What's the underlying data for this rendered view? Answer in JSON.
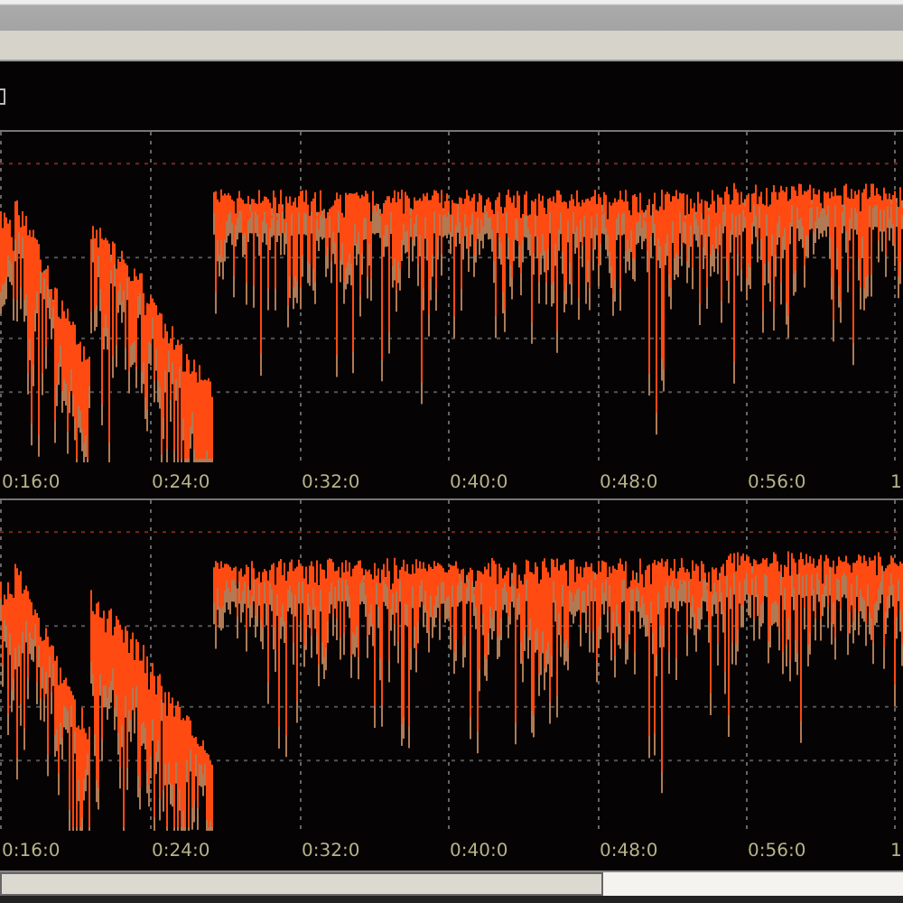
{
  "charts": [
    {
      "kind": "waveform",
      "time_labels": [
        "0:16:0",
        "0:24:0",
        "0:32:0",
        "0:40:0",
        "0:48:0",
        "0:56:0",
        "1"
      ]
    },
    {
      "kind": "waveform",
      "time_labels": [
        "0:16:0",
        "0:24:0",
        "0:32:0",
        "0:40:0",
        "0:48:0",
        "0:56:0",
        "1"
      ]
    }
  ]
}
